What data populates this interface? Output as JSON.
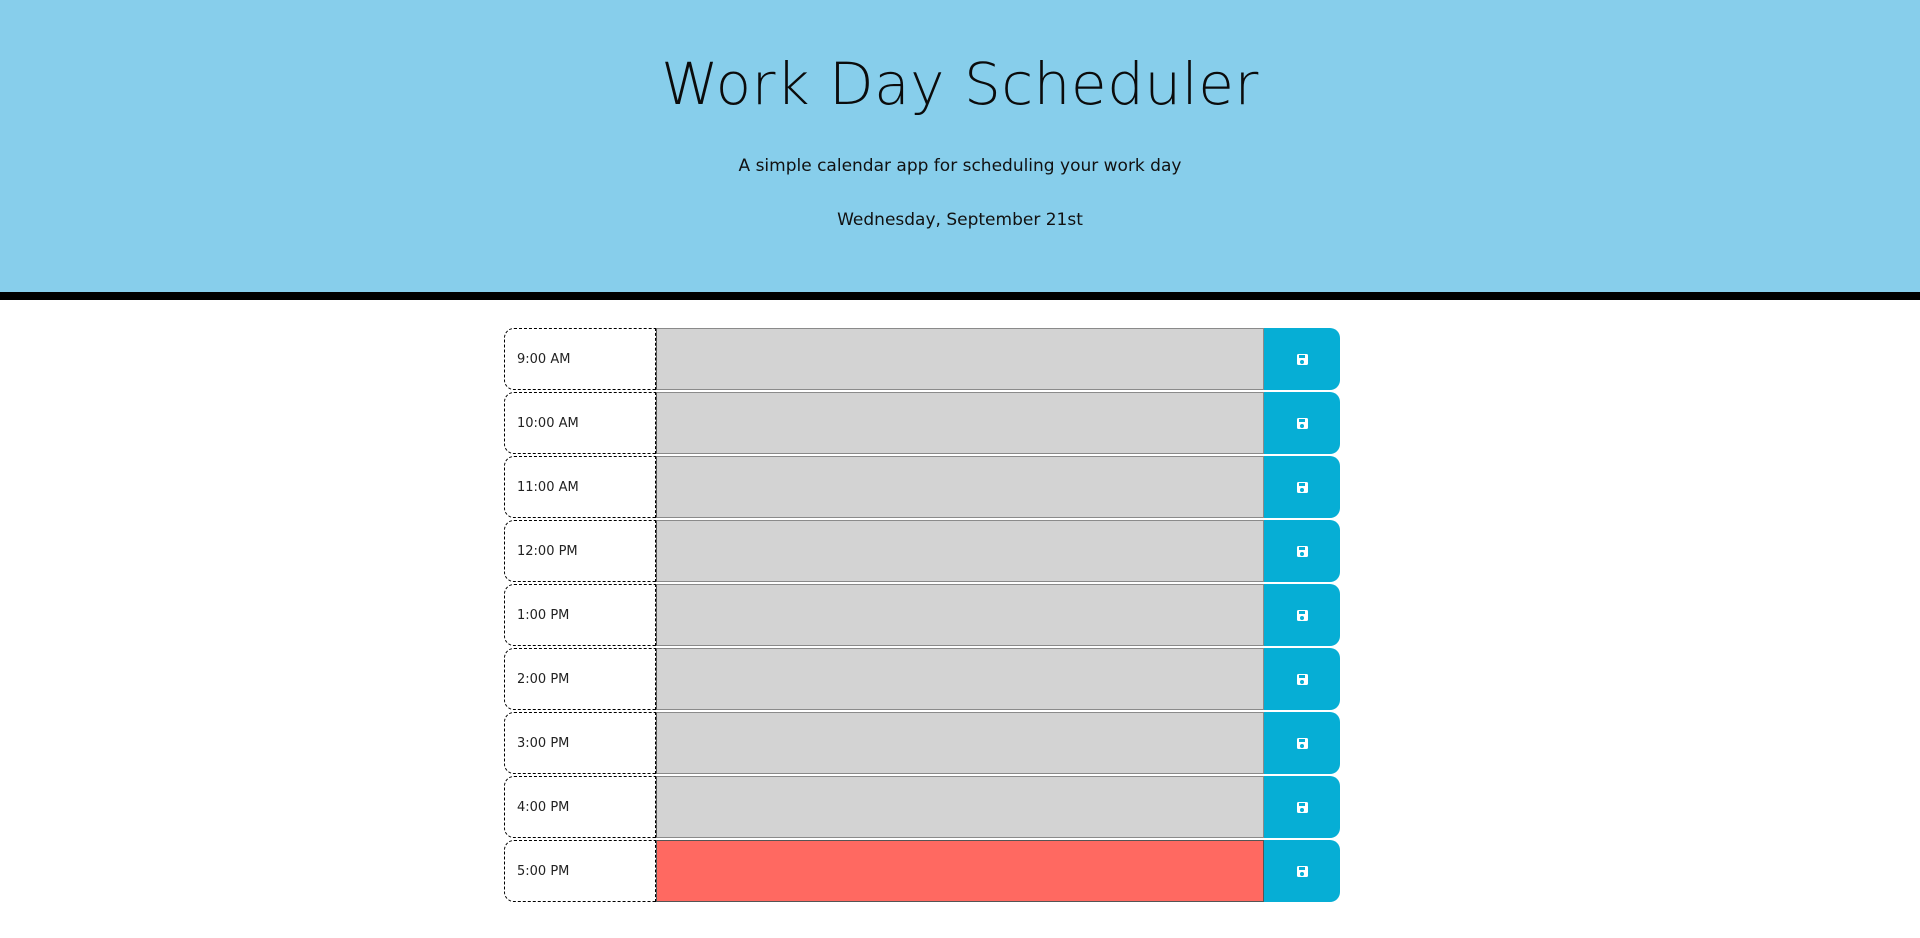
{
  "header": {
    "title": "Work Day Scheduler",
    "subtitle": "A simple calendar app for scheduling your work day",
    "current_day": "Wednesday, September 21st"
  },
  "colors": {
    "header_bg": "#87ceeb",
    "past": "#d3d3d3",
    "present": "#ff6961",
    "save_button": "#06aed5"
  },
  "save_icon": "floppy-disk-icon",
  "time_blocks": [
    {
      "hour": "9:00 AM",
      "text": "",
      "state": "past"
    },
    {
      "hour": "10:00 AM",
      "text": "",
      "state": "past"
    },
    {
      "hour": "11:00 AM",
      "text": "",
      "state": "past"
    },
    {
      "hour": "12:00 PM",
      "text": "",
      "state": "past"
    },
    {
      "hour": "1:00 PM",
      "text": "",
      "state": "past"
    },
    {
      "hour": "2:00 PM",
      "text": "",
      "state": "past"
    },
    {
      "hour": "3:00 PM",
      "text": "",
      "state": "past"
    },
    {
      "hour": "4:00 PM",
      "text": "",
      "state": "past"
    },
    {
      "hour": "5:00 PM",
      "text": "",
      "state": "present"
    }
  ]
}
